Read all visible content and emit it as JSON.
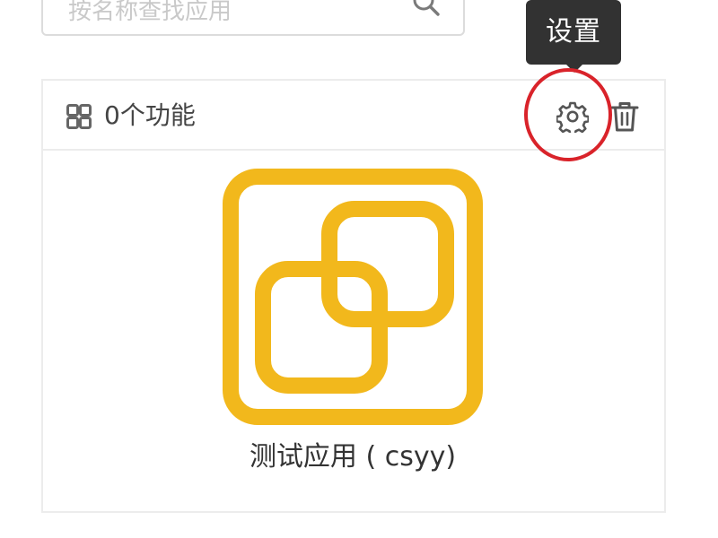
{
  "search": {
    "placeholder": "按名称查找应用",
    "icon": "search-icon"
  },
  "tooltip": {
    "text": "设置"
  },
  "card": {
    "feature_count_label": "0个功能",
    "feature_icon": "grid-icon",
    "settings_icon": "gear-icon",
    "delete_icon": "trash-icon",
    "app": {
      "name": "测试应用 ( csyy)",
      "logo_color": "#f2b81c"
    }
  },
  "colors": {
    "highlight": "#d9232a",
    "tooltip_bg": "#323232",
    "border": "#ececec"
  }
}
